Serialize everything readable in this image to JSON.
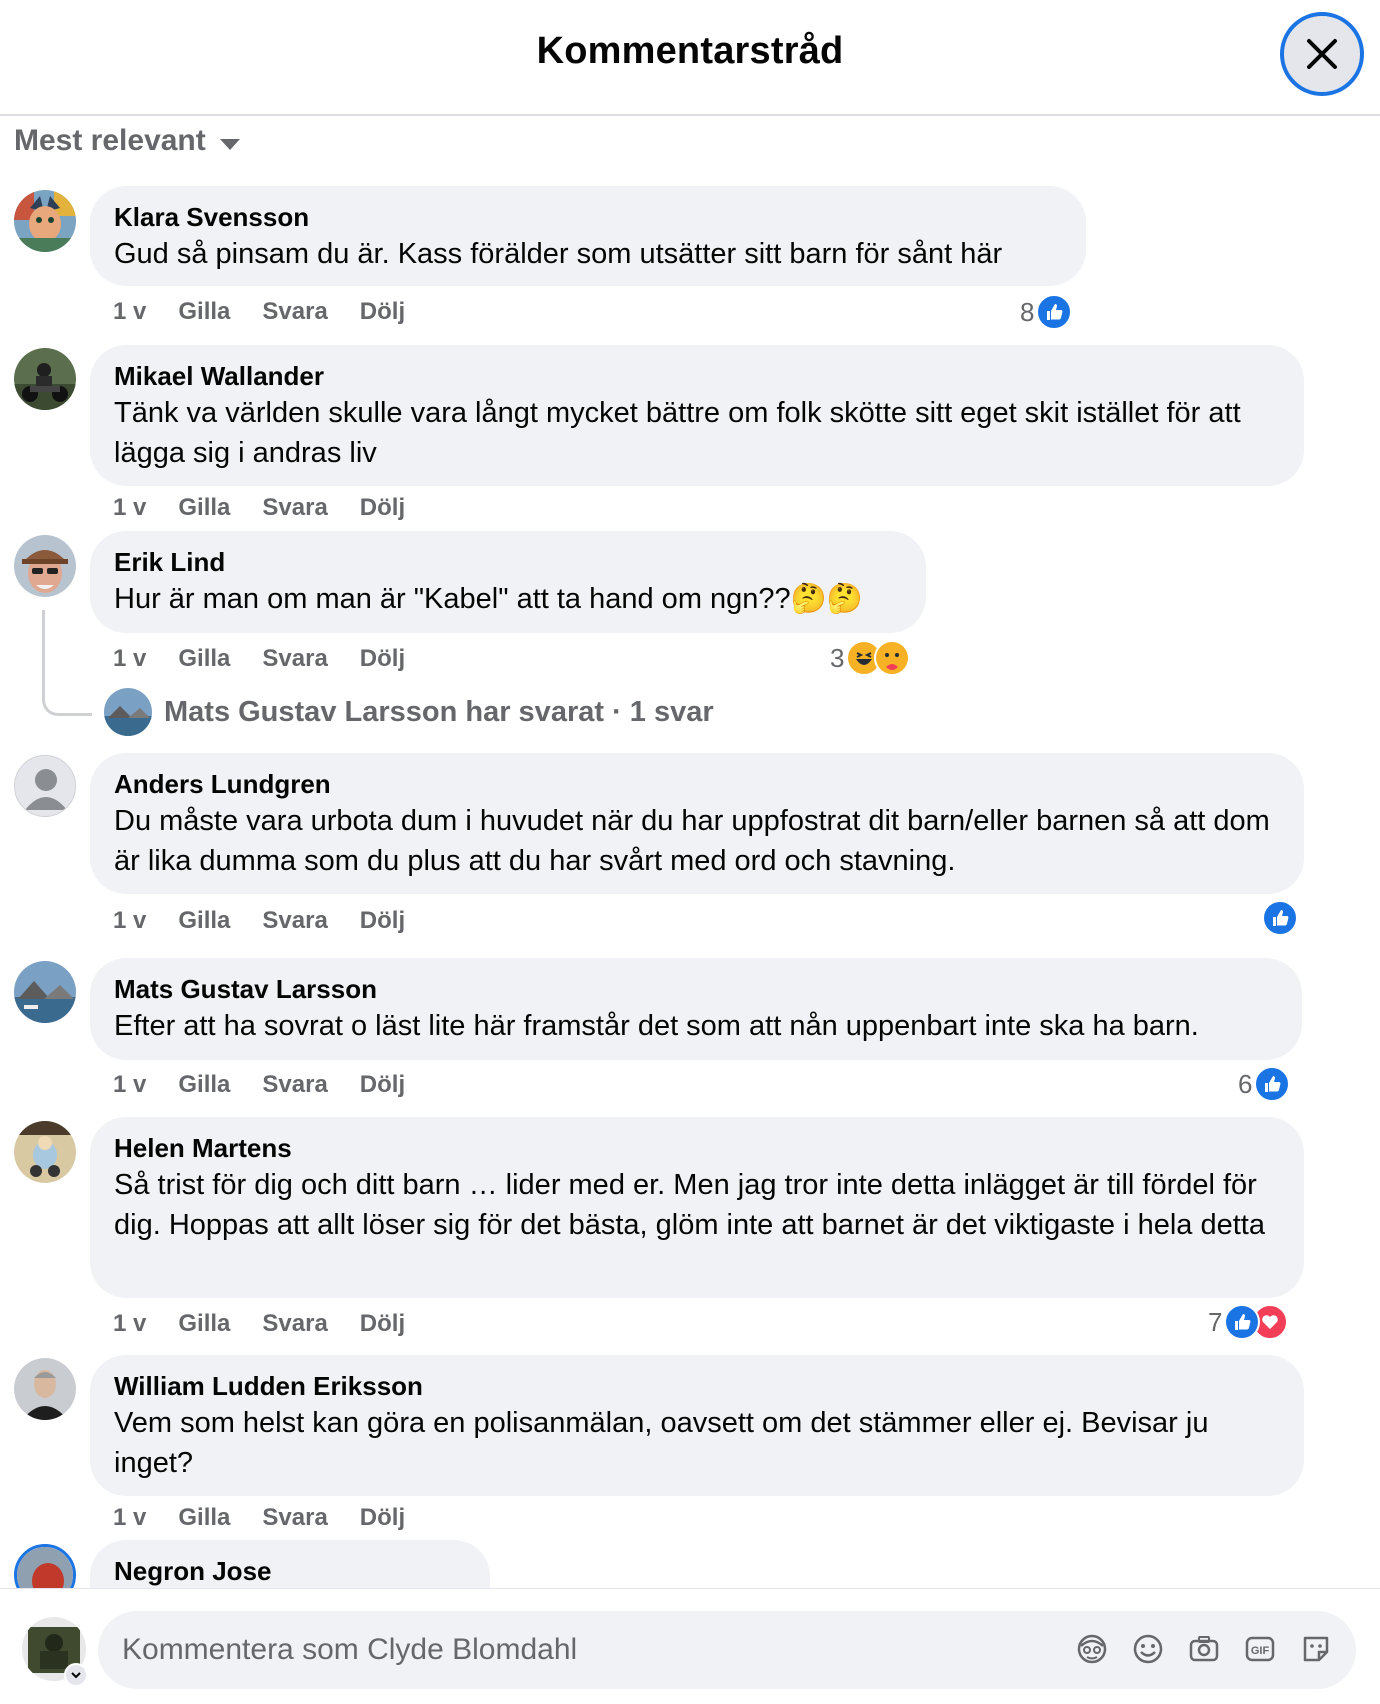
{
  "header": {
    "title": "Kommentarstråd"
  },
  "sort": {
    "label": "Mest relevant"
  },
  "actions": {
    "time": "1 v",
    "like": "Gilla",
    "reply": "Svara",
    "hide": "Dölj"
  },
  "comments": [
    {
      "author": "Klara Svensson",
      "text": "Gud så pinsam du är. Kass förälder som utsätter sitt barn för sånt här",
      "reaction_count": "8",
      "reactions": [
        "like"
      ]
    },
    {
      "author": "Mikael Wallander",
      "text": "Tänk va världen skulle vara långt mycket bättre om folk skötte sitt eget skit istället för att lägga sig i andras liv",
      "reaction_count": "",
      "reactions": []
    },
    {
      "author": "Erik Lind",
      "text": "Hur är man om man är \"Kabel\" att ta hand om ngn??🤔🤔",
      "reaction_count": "3",
      "reactions": [
        "haha",
        "care"
      ]
    },
    {
      "author": "Anders Lundgren",
      "text": "Du måste vara urbota dum i huvudet när du har uppfostrat dit barn/eller barnen så att dom är lika dumma som du plus att du har svårt med ord och stavning.",
      "reaction_count": "",
      "reactions": [
        "like"
      ]
    },
    {
      "author": "Mats Gustav Larsson",
      "text": "Efter att ha sovrat o läst lite här framstår det som att nån uppenbart inte ska ha barn.",
      "reaction_count": "6",
      "reactions": [
        "like"
      ]
    },
    {
      "author": "Helen Martens",
      "text": "Så trist för dig och ditt barn … lider med er. Men jag tror inte detta inlägget är till fördel för dig. Hoppas att allt löser sig för det bästa, glöm inte att barnet är det viktigaste i hela detta",
      "reaction_count": "7",
      "reactions": [
        "like",
        "love"
      ]
    },
    {
      "author": "William Ludden Eriksson",
      "text": "Vem som helst kan göra en polisanmälan, oavsett om det stämmer eller ej. Bevisar ju inget?",
      "reaction_count": "",
      "reactions": []
    },
    {
      "author": "Negron Jose",
      "text": "",
      "reaction_count": "",
      "reactions": []
    }
  ],
  "reply_summary": {
    "text": "Mats Gustav Larsson har svarat · 1 svar"
  },
  "composer": {
    "placeholder": "Kommentera som Clyde Blomdahl",
    "icons": [
      "avatar-sticker-icon",
      "emoji-icon",
      "camera-icon",
      "gif-icon",
      "sticker-icon"
    ]
  },
  "colors": {
    "accent": "#1b74e4",
    "bubble": "#f0f2f5",
    "meta": "#65676b",
    "love": "#f33e58"
  }
}
